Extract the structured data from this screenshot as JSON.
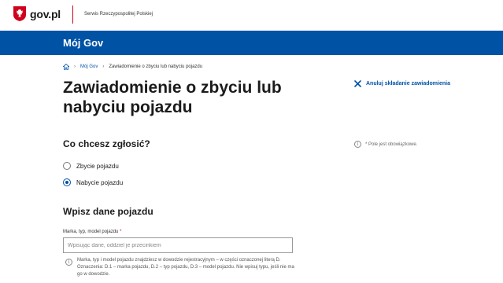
{
  "topbar": {
    "brand": "gov.pl",
    "service": "Serwis Rzeczypospolitej Polskiej"
  },
  "header": {
    "title": "Mój Gov"
  },
  "breadcrumb": {
    "home_icon": "home-icon",
    "items": [
      "Mój Gov",
      "Zawiadomienie o zbyciu lub nabyciu pojazdu"
    ]
  },
  "page": {
    "title": "Zawiadomienie o zbyciu lub nabyciu pojazdu",
    "cancel_label": "Anuluj składanie zawiadomienia",
    "required_note": "* Pole jest obowiązkowe."
  },
  "question": {
    "title": "Co chcesz zgłosić?",
    "options": [
      {
        "label": "Zbycie pojazdu",
        "checked": false
      },
      {
        "label": "Nabycie pojazdu",
        "checked": true
      }
    ]
  },
  "vehicle": {
    "section_title": "Wpisz dane pojazdu",
    "field_label": "Marka, typ, model pojazdu",
    "required_mark": "*",
    "placeholder": "Wpisując dane, oddziel je przecinkiem",
    "value": "",
    "hint": "Marka, typ i model pojazdu znajdziesz w dowodzie rejestracyjnym – w części oznaczonej literą D. Oznaczenia: D.1 – marka pojazdu, D.2 – typ pojazdu, D.3 – model pojazdu. Nie wpisuj typu, jeśli nie ma go w dowodzie."
  },
  "colors": {
    "brand_blue": "#0052a5",
    "accent_red": "#d0021b"
  }
}
